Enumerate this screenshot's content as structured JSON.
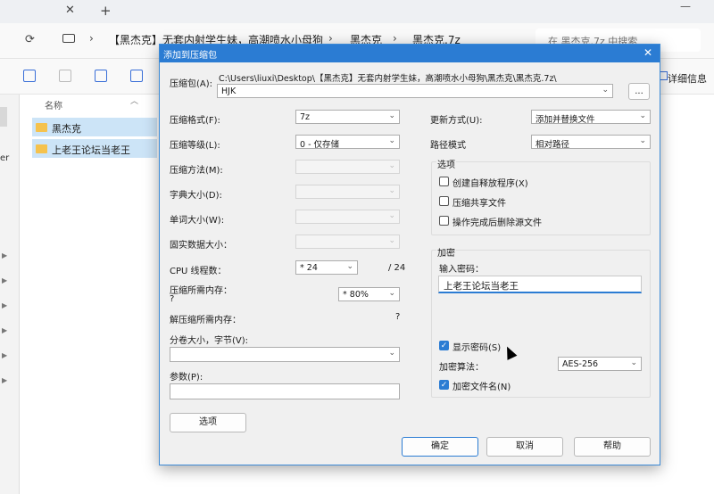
{
  "explorer": {
    "breadcrumbs": [
      "【黑杰克】无套内射学生妹，高潮喷水小母狗",
      "黑杰克",
      "黑杰克.7z"
    ],
    "search_placeholder": "在 黑杰克.7z 中搜索",
    "details_label": "详细信息",
    "column_name": "名称",
    "files": [
      "黑杰克",
      "上老王论坛当老王"
    ],
    "nav_truncated": "er"
  },
  "dialog": {
    "title": "添加到压缩包",
    "archive_label": "压缩包(A):",
    "archive_path": "C:\\Users\\liuxi\\Desktop\\【黑杰克】无套内射学生妹，高潮喷水小母狗\\黑杰克\\黑杰克.7z\\",
    "archive_name": "HJK",
    "browse_label": "...",
    "format_label": "压缩格式(F):",
    "format_value": "7z",
    "level_label": "压缩等级(L):",
    "level_value": "0 - 仅存储",
    "method_label": "压缩方法(M):",
    "dict_label": "字典大小(D):",
    "word_label": "单词大小(W):",
    "solid_label": "固实数据大小：",
    "cpu_label": "CPU 线程数：",
    "cpu_value": "* 24",
    "cpu_total": "/ 24",
    "mem_label": "压缩所需内存：",
    "mem_q": "?",
    "mem_value": "* 80%",
    "decomp_label": "解压缩所需内存：",
    "decomp_q": "?",
    "split_label": "分卷大小，字节(V):",
    "params_label": "参数(P):",
    "options_button": "选项",
    "update_label": "更新方式(U):",
    "update_value": "添加并替换文件",
    "pathmode_label": "路径模式",
    "pathmode_value": "相对路径",
    "options_group": "选项",
    "opt_sfx": "创建自释放程序(X)",
    "opt_shared": "压缩共享文件",
    "opt_delete": "操作完成后删除源文件",
    "encrypt_group": "加密",
    "password_label": "输入密码：",
    "password_value": "上老王论坛当老王",
    "show_password": "显示密码(S)",
    "algo_label": "加密算法：",
    "algo_value": "AES-256",
    "encrypt_names": "加密文件名(N)",
    "ok": "确定",
    "cancel": "取消",
    "help": "帮助"
  }
}
